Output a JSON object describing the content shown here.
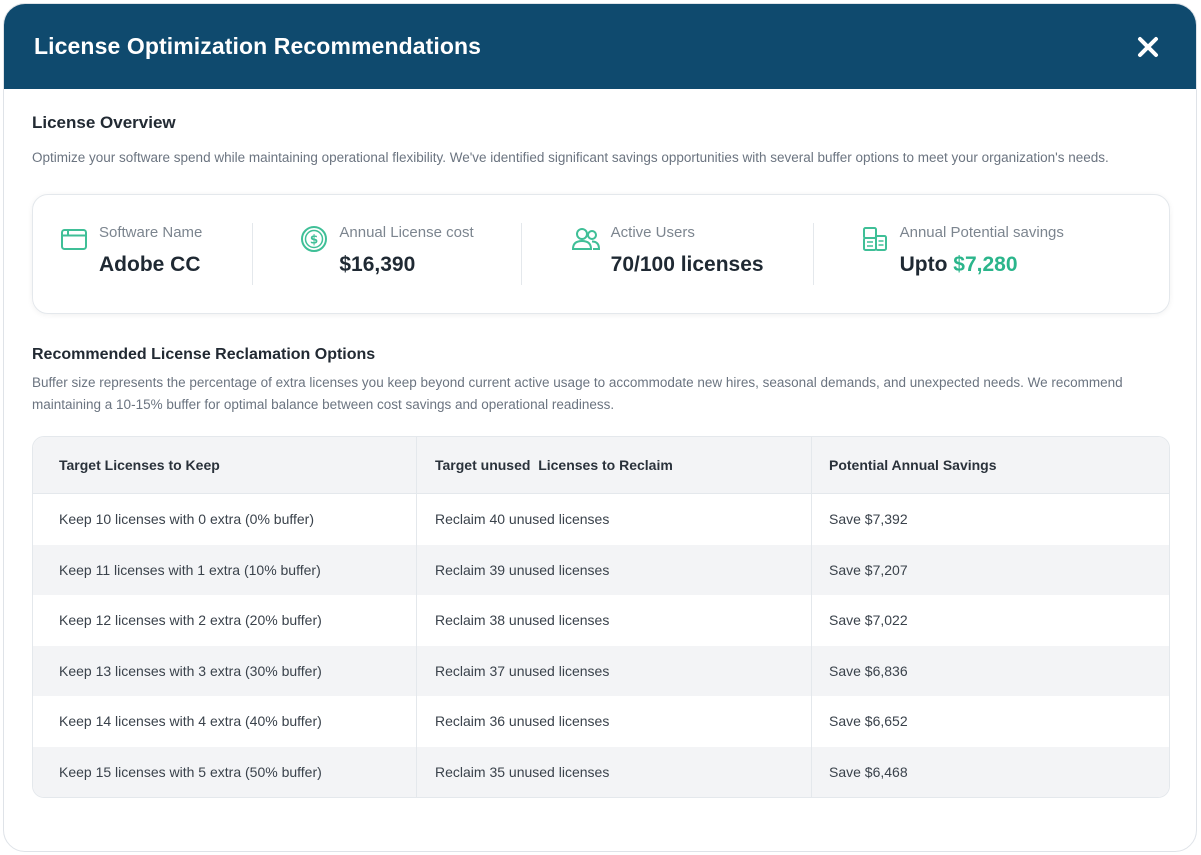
{
  "header": {
    "title": "License Optimization Recommendations",
    "close_icon": "close-icon"
  },
  "overview": {
    "title": "License Overview",
    "description": "Optimize your software spend while maintaining operational flexibility. We've identified significant savings opportunities with several buffer options to meet your organization's needs.",
    "stats": {
      "software": {
        "icon": "browser-window-icon",
        "label": "Software Name",
        "value": "Adobe CC"
      },
      "cost": {
        "icon": "dollar-coin-icon",
        "label": "Annual License cost",
        "value": "$16,390"
      },
      "users": {
        "icon": "users-icon",
        "label": "Active Users",
        "value": "70/100 licenses"
      },
      "savings": {
        "icon": "savings-stack-icon",
        "label": "Annual Potential savings",
        "prefix": "Upto",
        "value": "$7,280"
      }
    }
  },
  "reclamation": {
    "title": "Recommended License Reclamation Options",
    "description": "Buffer size represents the percentage of extra licenses you keep beyond current active usage to accommodate new hires, seasonal demands, and unexpected needs. We recommend maintaining a 10-15% buffer for optimal balance between cost savings and operational readiness.",
    "columns": [
      "Target Licenses to Keep",
      "Target unused  Licenses to Reclaim",
      "Potential Annual Savings"
    ],
    "rows": [
      [
        "Keep 10 licenses with 0 extra (0% buffer)",
        "Reclaim 40 unused licenses",
        "Save $7,392"
      ],
      [
        "Keep 11 licenses with 1 extra (10% buffer)",
        "Reclaim 39 unused licenses",
        "Save $7,207"
      ],
      [
        "Keep 12 licenses with 2 extra (20% buffer)",
        "Reclaim 38 unused licenses",
        "Save $7,022"
      ],
      [
        "Keep 13 licenses with 3 extra (30% buffer)",
        "Reclaim 37 unused licenses",
        "Save $6,836"
      ],
      [
        "Keep 14 licenses with 4 extra (40% buffer)",
        "Reclaim 36 unused licenses",
        "Save $6,652"
      ],
      [
        "Keep 15 licenses with 5 extra (50% buffer)",
        "Reclaim 35 unused licenses",
        "Save $6,468"
      ]
    ]
  },
  "colors": {
    "header_bg": "#0f4a6e",
    "accent_green": "#2bb58b",
    "stripe": "#f3f4f6"
  }
}
